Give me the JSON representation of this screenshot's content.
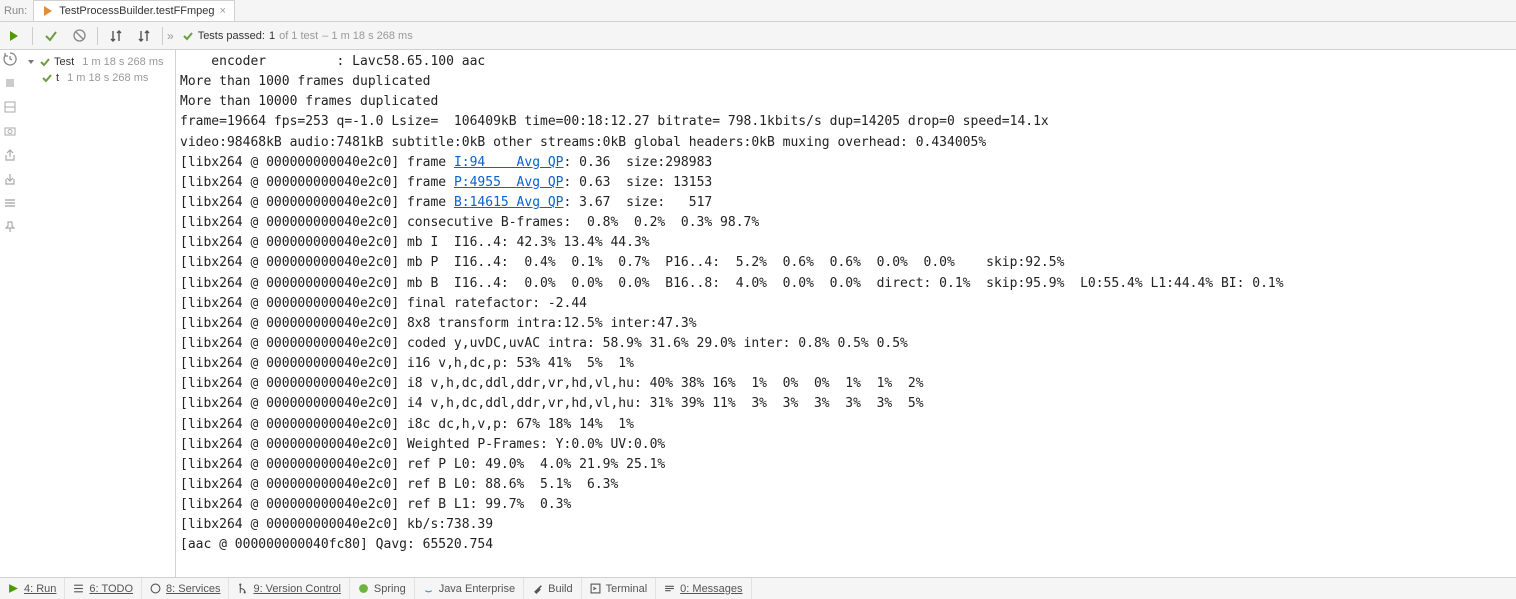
{
  "tabbar": {
    "label": "Run:",
    "tab_name": "TestProcessBuilder.testFFmpeg"
  },
  "toolbar": {
    "status_prefix": "Tests passed:",
    "status_count": "1",
    "status_of": "of 1 test",
    "status_time": "– 1 m 18 s 268 ms"
  },
  "tree": {
    "root_label": "Test",
    "root_time": "1 m 18 s 268 ms",
    "child_label": "t",
    "child_time": "1 m 18 s 268 ms"
  },
  "console": {
    "l0": "    encoder         : Lavc58.65.100 aac",
    "l1": "More than 1000 frames duplicated",
    "l2": "More than 10000 frames duplicated",
    "l3": "frame=19664 fps=253 q=-1.0 Lsize=  106409kB time=00:18:12.27 bitrate= 798.1kbits/s dup=14205 drop=0 speed=14.1x",
    "l4": "video:98468kB audio:7481kB subtitle:0kB other streams:0kB global headers:0kB muxing overhead: 0.434005%",
    "l5p": "[libx264 @ 000000000040e2c0] frame ",
    "l5a": "I:94    Avg QP",
    "l5s": ": 0.36  size:298983",
    "l6p": "[libx264 @ 000000000040e2c0] frame ",
    "l6a": "P:4955  Avg QP",
    "l6s": ": 0.63  size: 13153",
    "l7p": "[libx264 @ 000000000040e2c0] frame ",
    "l7a": "B:14615 Avg QP",
    "l7s": ": 3.67  size:   517",
    "l8": "[libx264 @ 000000000040e2c0] consecutive B-frames:  0.8%  0.2%  0.3% 98.7%",
    "l9": "[libx264 @ 000000000040e2c0] mb I  I16..4: 42.3% 13.4% 44.3%",
    "l10": "[libx264 @ 000000000040e2c0] mb P  I16..4:  0.4%  0.1%  0.7%  P16..4:  5.2%  0.6%  0.6%  0.0%  0.0%    skip:92.5%",
    "l11": "[libx264 @ 000000000040e2c0] mb B  I16..4:  0.0%  0.0%  0.0%  B16..8:  4.0%  0.0%  0.0%  direct: 0.1%  skip:95.9%  L0:55.4% L1:44.4% BI: 0.1%",
    "l12": "[libx264 @ 000000000040e2c0] final ratefactor: -2.44",
    "l13": "[libx264 @ 000000000040e2c0] 8x8 transform intra:12.5% inter:47.3%",
    "l14": "[libx264 @ 000000000040e2c0] coded y,uvDC,uvAC intra: 58.9% 31.6% 29.0% inter: 0.8% 0.5% 0.5%",
    "l15": "[libx264 @ 000000000040e2c0] i16 v,h,dc,p: 53% 41%  5%  1%",
    "l16": "[libx264 @ 000000000040e2c0] i8 v,h,dc,ddl,ddr,vr,hd,vl,hu: 40% 38% 16%  1%  0%  0%  1%  1%  2%",
    "l17": "[libx264 @ 000000000040e2c0] i4 v,h,dc,ddl,ddr,vr,hd,vl,hu: 31% 39% 11%  3%  3%  3%  3%  3%  5%",
    "l18": "[libx264 @ 000000000040e2c0] i8c dc,h,v,p: 67% 18% 14%  1%",
    "l19": "[libx264 @ 000000000040e2c0] Weighted P-Frames: Y:0.0% UV:0.0%",
    "l20": "[libx264 @ 000000000040e2c0] ref P L0: 49.0%  4.0% 21.9% 25.1%",
    "l21": "[libx264 @ 000000000040e2c0] ref B L0: 88.6%  5.1%  6.3%",
    "l22": "[libx264 @ 000000000040e2c0] ref B L1: 99.7%  0.3%",
    "l23": "[libx264 @ 000000000040e2c0] kb/s:738.39",
    "l24": "[aac @ 000000000040fc80] Qavg: 65520.754"
  },
  "bottom": {
    "run": "4: Run",
    "todo": "6: TODO",
    "services": "8: Services",
    "vcs": "9: Version Control",
    "spring": "Spring",
    "java": "Java Enterprise",
    "build": "Build",
    "terminal": "Terminal",
    "messages": "0: Messages"
  }
}
